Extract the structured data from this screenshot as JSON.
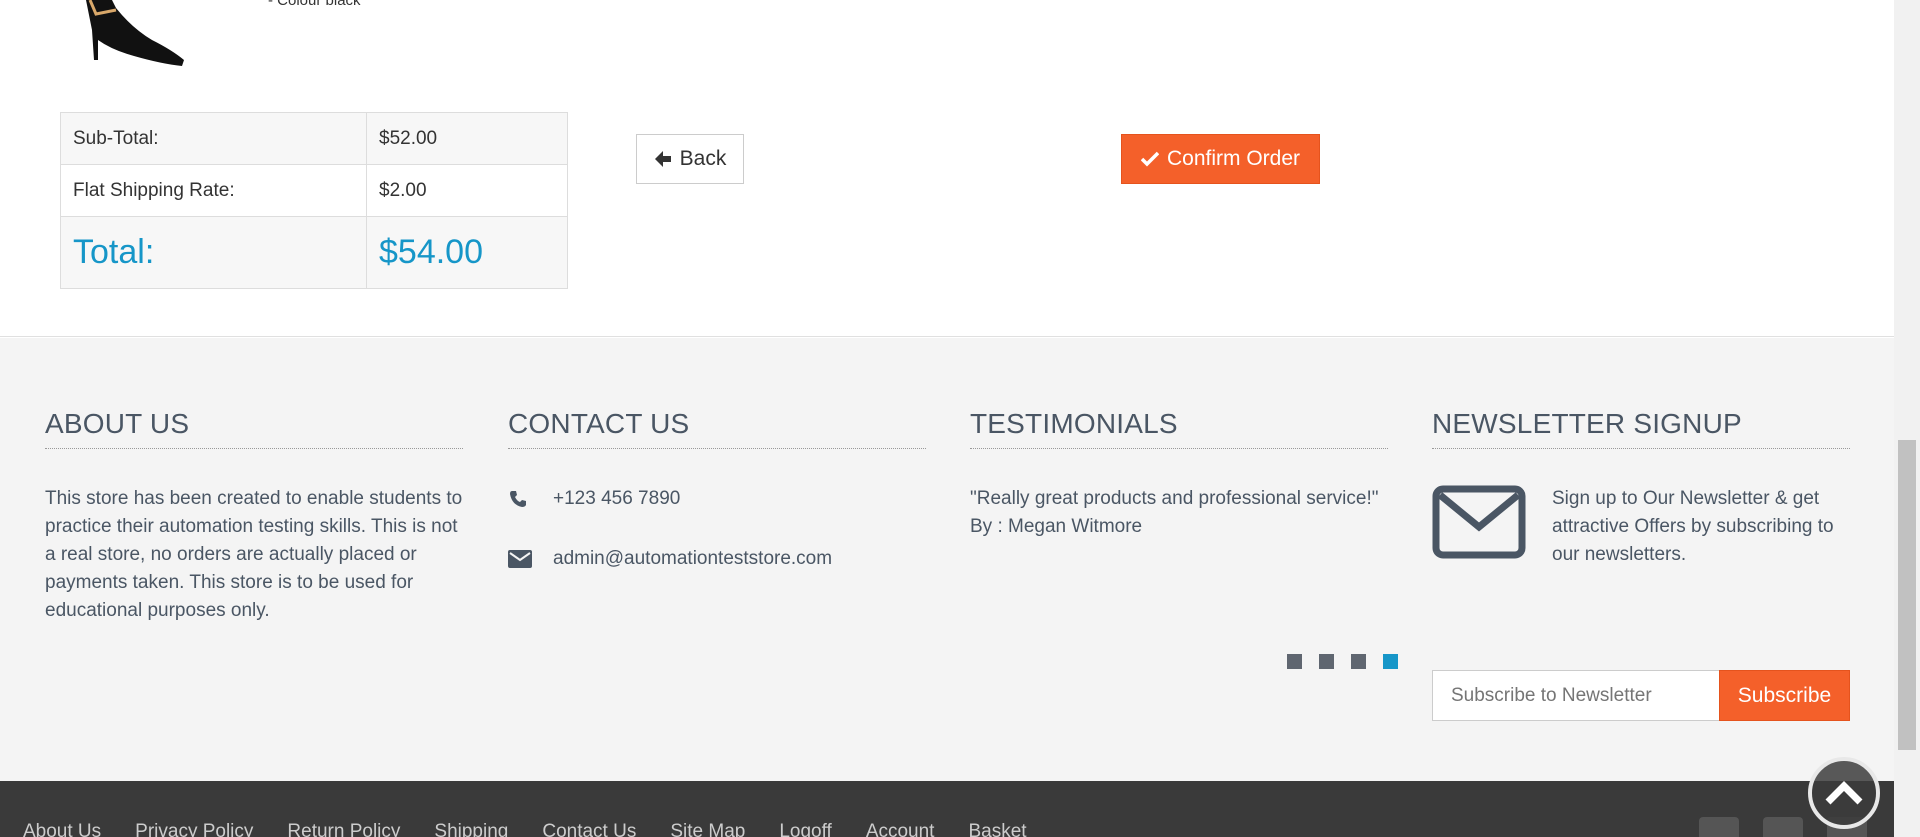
{
  "product": {
    "option_text": "- Colour black"
  },
  "totals": {
    "rows": [
      {
        "label": "Sub-Total:",
        "value": "$52.00"
      },
      {
        "label": "Flat Shipping Rate:",
        "value": "$2.00"
      },
      {
        "label": "Total:",
        "value": "$54.00"
      }
    ]
  },
  "actions": {
    "back_label": "Back",
    "confirm_label": "Confirm Order"
  },
  "footer": {
    "about": {
      "title": "ABOUT US",
      "text": "This store has been created to enable students to practice their automation testing skills. This is not a real store, no orders are actually placed or payments taken. This store is to be used for educational purposes only."
    },
    "contact": {
      "title": "CONTACT US",
      "phone": "+123 456 7890",
      "email": "admin@automationteststore.com"
    },
    "testimonials": {
      "title": "TESTIMONIALS",
      "quote": "\"Really great products and professional service!\"",
      "author": "By : Megan Witmore",
      "pages": 4,
      "active_page": 4
    },
    "newsletter": {
      "title": "NEWSLETTER SIGNUP",
      "text": "Sign up to Our Newsletter & get attractive Offers by subscribing to our newsletters.",
      "placeholder": "Subscribe to Newsletter",
      "button_label": "Subscribe"
    }
  },
  "bottom_links": [
    "About Us",
    "Privacy Policy",
    "Return Policy",
    "Shipping",
    "Contact Us",
    "Site Map",
    "Logoff",
    "Account",
    "Basket"
  ],
  "colors": {
    "accent": "#f4602a",
    "link": "#1696c8",
    "footer_bg": "#f4f4f4",
    "bottom_bar": "#3a3a3a"
  }
}
